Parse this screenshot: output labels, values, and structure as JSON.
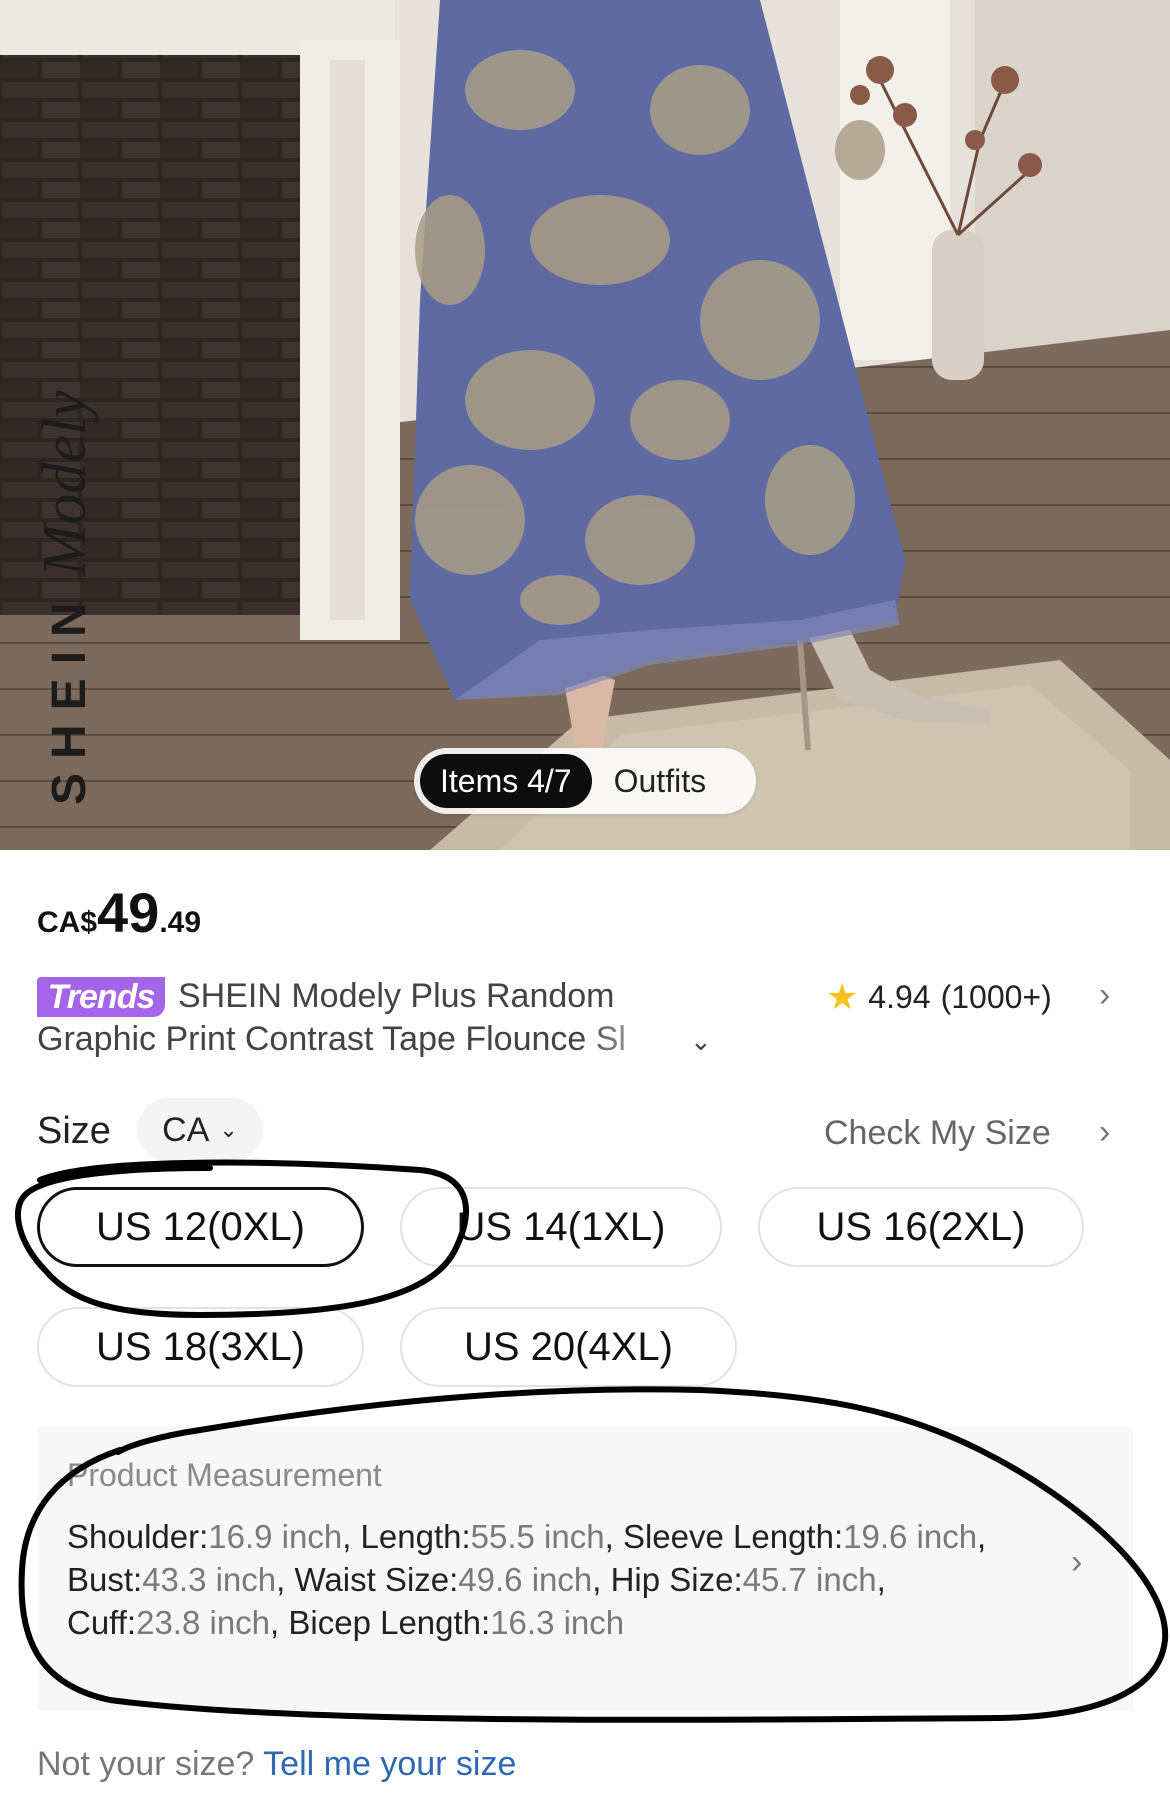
{
  "photo": {
    "watermark_brand": "SHEIN",
    "watermark_sub": "Modely",
    "gallery_active": "Items 4/7",
    "gallery_tab": "Outfits"
  },
  "price": {
    "currency": "CA$",
    "integer": "49",
    "decimal": ".49"
  },
  "product": {
    "badge": "Trends",
    "title_line1": "SHEIN Modely Plus Random",
    "title_line2": "Graphic Print Contrast Tape Flounce Sl",
    "rating_value": "4.94",
    "rating_count": "(1000+)"
  },
  "size": {
    "label": "Size",
    "region": "CA",
    "check_my_size": "Check My Size",
    "options": [
      "US 12(0XL)",
      "US 14(1XL)",
      "US 16(2XL)",
      "US 18(3XL)",
      "US 20(4XL)"
    ],
    "selected": "US 12(0XL)"
  },
  "measurement": {
    "title": "Product Measurement",
    "items": [
      {
        "label": "Shoulder:",
        "value": "16.9 inch"
      },
      {
        "label": "Length:",
        "value": "55.5 inch"
      },
      {
        "label": "Sleeve Length:",
        "value": "19.6 inch"
      },
      {
        "label": "Bust:",
        "value": "43.3 inch"
      },
      {
        "label": "Waist Size:",
        "value": "49.6 inch"
      },
      {
        "label": "Hip Size:",
        "value": "45.7 inch"
      },
      {
        "label": "Cuff:",
        "value": "23.8 inch"
      },
      {
        "label": "Bicep Length:",
        "value": "16.3 inch"
      }
    ]
  },
  "footer": {
    "prompt": "Not your size?",
    "link": "Tell me your size"
  },
  "colors": {
    "trends_purple": "#a565e8",
    "link_blue": "#2d68b2",
    "star_yellow": "#f8c21b",
    "dress_blue": "#5f6aa3"
  }
}
